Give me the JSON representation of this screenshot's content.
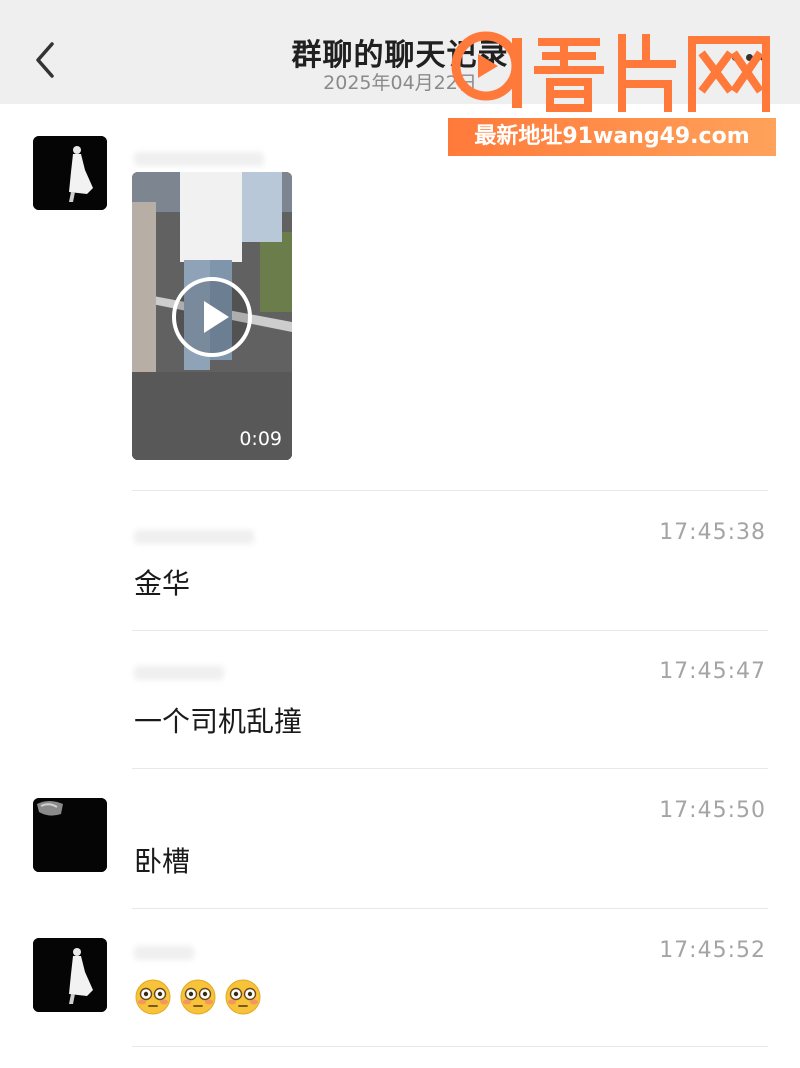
{
  "header": {
    "title": "群聊的聊天记录",
    "date": "2025年04月22日",
    "back_icon": "chevron-left-icon",
    "more_icon": "more-dots-icon"
  },
  "watermark": {
    "logo_text": "91看片网",
    "banner_text": "最新地址91wang49.com",
    "color": "#ff7a3a"
  },
  "messages": [
    {
      "type": "video",
      "avatar": "silhouette-avatar",
      "duration": "0:09"
    },
    {
      "type": "text",
      "time": "17:45:38",
      "text": "金华"
    },
    {
      "type": "text",
      "time": "17:45:47",
      "text": "一个司机乱撞"
    },
    {
      "type": "text",
      "avatar": "dark-avatar",
      "time": "17:45:50",
      "text": "卧槽"
    },
    {
      "type": "emoji",
      "avatar": "silhouette-avatar",
      "time": "17:45:52",
      "emojis": [
        "flushed-face",
        "flushed-face",
        "flushed-face"
      ]
    }
  ]
}
